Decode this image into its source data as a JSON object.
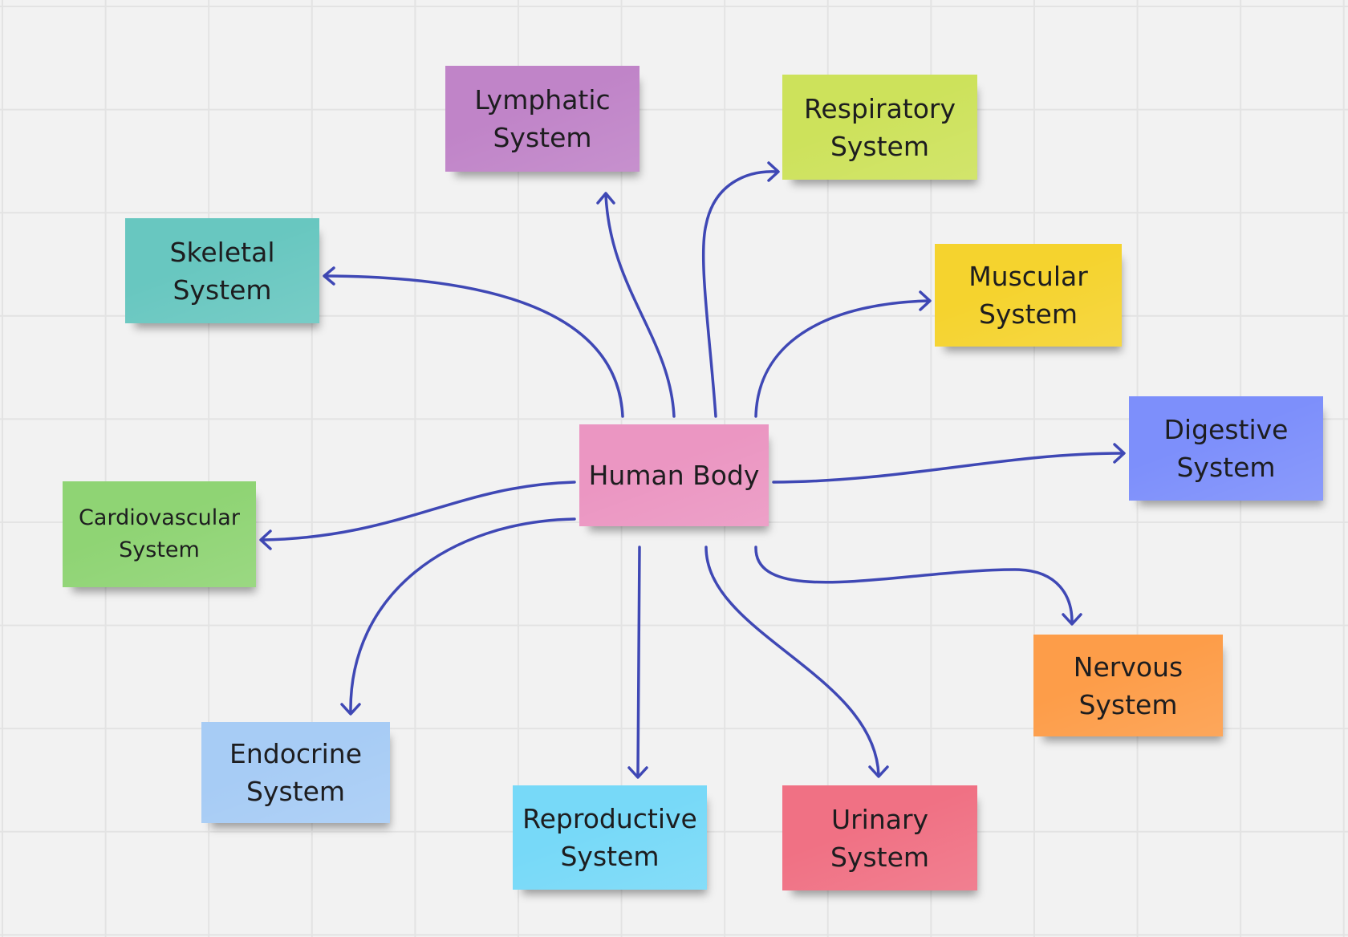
{
  "board": {
    "background": "#f2f2f2",
    "grid_color": "#e3e3e3",
    "connector_color": "#3f48b5"
  },
  "center": {
    "label": "Human Body",
    "color": "#eb96c2"
  },
  "notes": [
    {
      "id": "lymphatic",
      "label": "Lymphatic\nSystem",
      "color": "#c084c8"
    },
    {
      "id": "respiratory",
      "label": "Respiratory\nSystem",
      "color": "#cde25b"
    },
    {
      "id": "skeletal",
      "label": "Skeletal\nSystem",
      "color": "#68c7c0"
    },
    {
      "id": "muscular",
      "label": "Muscular\nSystem",
      "color": "#f5d32e"
    },
    {
      "id": "digestive",
      "label": "Digestive\nSystem",
      "color": "#7d8ffb"
    },
    {
      "id": "cardiovascular",
      "label": "Cardiovascular\nSystem",
      "color": "#8fd474"
    },
    {
      "id": "endocrine",
      "label": "Endocrine\nSystem",
      "color": "#a7ccf5"
    },
    {
      "id": "reproductive",
      "label": "Reproductive\nSystem",
      "color": "#77d9f8"
    },
    {
      "id": "urinary",
      "label": "Urinary\nSystem",
      "color": "#f07184"
    },
    {
      "id": "nervous",
      "label": "Nervous\nSystem",
      "color": "#fd9d49"
    }
  ]
}
